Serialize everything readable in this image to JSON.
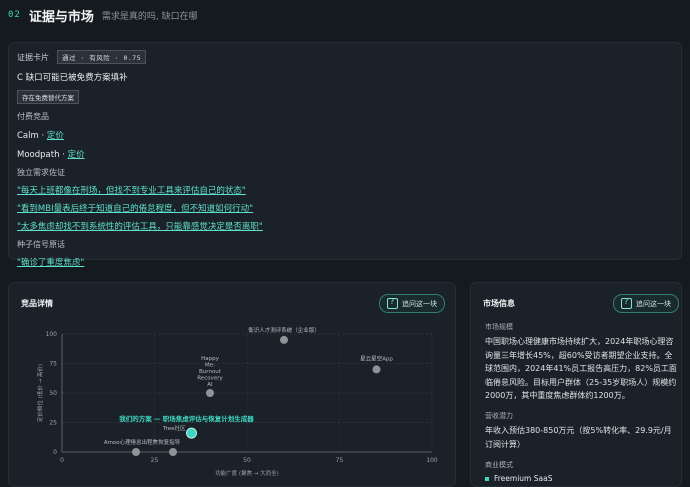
{
  "header": {
    "num": "02",
    "title": "证据与市场",
    "subtitle": "需求是真的吗, 缺口在哪"
  },
  "evidence": {
    "card_label": "证据卡片",
    "verdict_tag": "通过 · 有风险 · 0.75",
    "summary": "C 缺口可能已被免费方案填补",
    "free_alt_tag": "存在免费替代方案",
    "paid_label": "付费竞品",
    "paid": [
      {
        "name": "Calm",
        "sep": " · ",
        "link": "定价"
      },
      {
        "name": "Moodpath",
        "sep": " · ",
        "link": "定价"
      }
    ],
    "independent_label": "独立需求佐证",
    "quotes": [
      "\"每天上班都像在刑场，但找不到专业工具来评估自己的状态\"",
      "\"看到MBI量表后终于知道自己的倦怠程度，但不知道如何行动\"",
      "\"太多焦虑却找不到系统性的评估工具，只能靠感觉决定是否离职\""
    ],
    "seed_label": "种子信号原话",
    "seed_quote": "\"确诊了重度焦虑\""
  },
  "competition": {
    "title": "竞品详情",
    "ask_label": "追问这一块"
  },
  "market": {
    "title": "市场信息",
    "ask_label": "追问这一块",
    "size_label": "市场规模",
    "size_text": "中国职场心理健康市场持续扩大，2024年职场心理咨询量三年增长45%，超60%受访者期望企业支持。全球范围内，2024年41%员工报告高压力，82%员工面临倦怠风险。目标用户群体（25-35岁职场人）规模约2000万，其中重度焦虑群体约1200万。",
    "revenue_label": "营收潜力",
    "revenue_text": "年收入预估380-850万元（按5%转化率、29.9元/月订阅计算）",
    "model_label": "商业模式",
    "model_item": "Freemium SaaS"
  },
  "chart_data": {
    "type": "scatter",
    "xlabel": "功能广度 (聚焦 → 大而全)",
    "ylabel": "定价档位 (低价 → 高价)",
    "xlim": [
      0,
      100
    ],
    "ylim": [
      0,
      100
    ],
    "xticks": [
      "0",
      "25",
      "50",
      "75",
      "100"
    ],
    "yticks": [
      "0",
      "25",
      "50",
      "75",
      "100"
    ],
    "grid": true,
    "points": [
      {
        "label": "衡识人才测评系统（企业版）",
        "x": 60,
        "y": 95,
        "highlight": false
      },
      {
        "label": "星云星空App",
        "x": 85,
        "y": 70,
        "highlight": false
      },
      {
        "label": "Happy Me: Burnout Recovery AI",
        "x": 40,
        "y": 50,
        "highlight": false
      },
      {
        "label": "Tree社区",
        "x": 35,
        "y": 16,
        "highlight": true
      },
      {
        "label": "Amoo心理倦怠出程焦恢复指导",
        "x": 20,
        "y": 0,
        "highlight": false
      },
      {
        "label": "",
        "x": 30,
        "y": 0,
        "highlight": false
      }
    ],
    "annotation": "我们的方案 — 职场焦虑评估与恢复计划生成器",
    "colors": {
      "point": "#8e9398",
      "highlight": "#3ed6c0",
      "annotation": "#3ed6c0"
    }
  }
}
